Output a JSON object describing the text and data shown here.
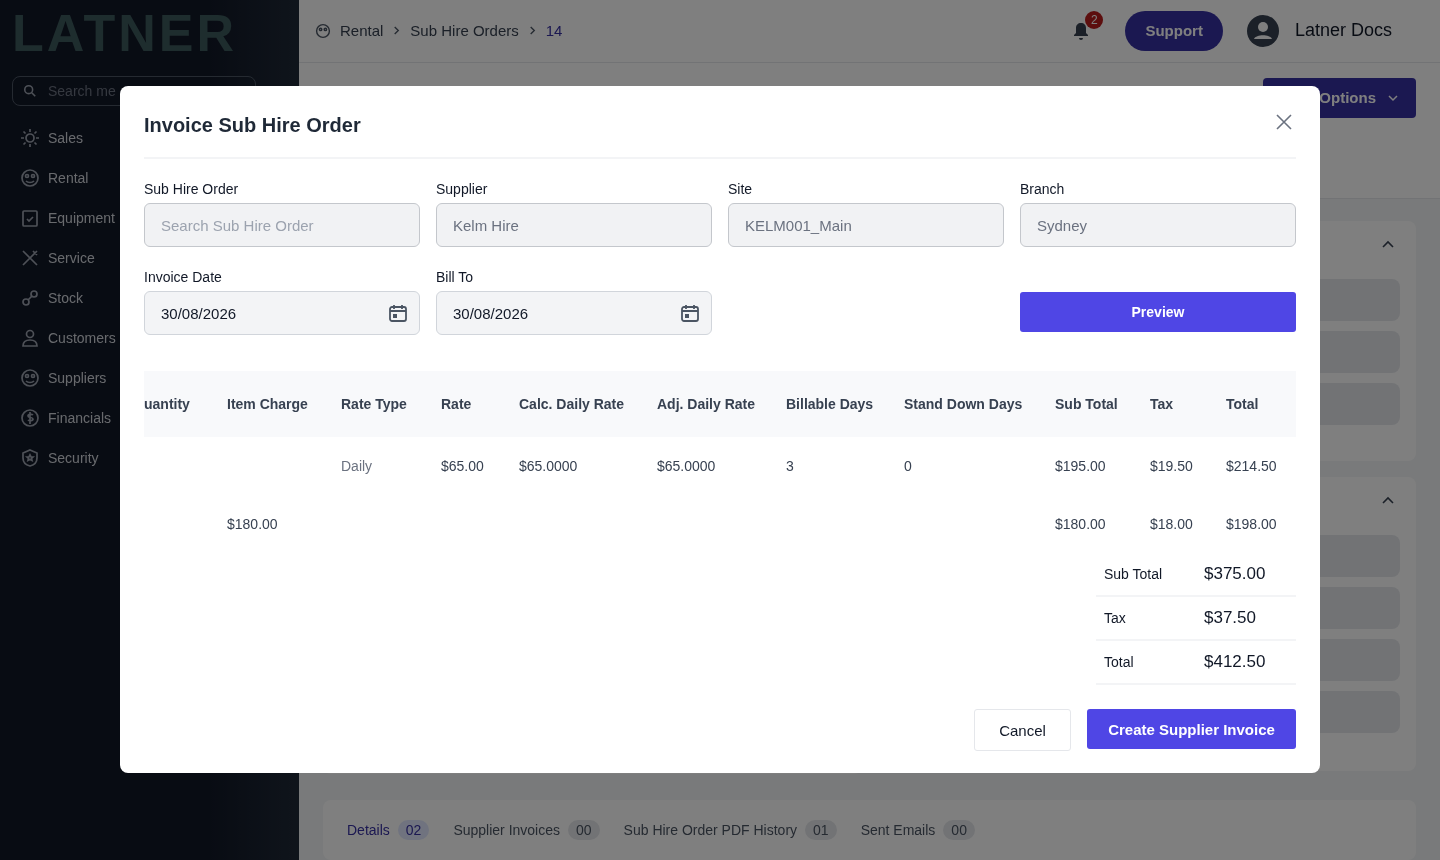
{
  "sidebar": {
    "logo": "LATNER",
    "search": {
      "placeholder": "Search me"
    },
    "items": [
      {
        "label": "Sales"
      },
      {
        "label": "Rental"
      },
      {
        "label": "Equipment"
      },
      {
        "label": "Service"
      },
      {
        "label": "Stock"
      },
      {
        "label": "Customers"
      },
      {
        "label": "Suppliers"
      },
      {
        "label": "Financials"
      },
      {
        "label": "Security"
      }
    ]
  },
  "breadcrumb": [
    {
      "label": "Rental",
      "current": false
    },
    {
      "label": "Sub Hire Orders",
      "current": false
    },
    {
      "label": "14",
      "current": true
    }
  ],
  "header": {
    "notifications": "2",
    "support": "Support",
    "user": "Latner Docs"
  },
  "page": {
    "options_button": "Options"
  },
  "tabs": [
    {
      "label": "Details",
      "count": "02",
      "selected": true
    },
    {
      "label": "Supplier Invoices",
      "count": "00",
      "selected": false
    },
    {
      "label": "Sub Hire Order PDF History",
      "count": "01",
      "selected": false
    },
    {
      "label": "Sent Emails",
      "count": "00",
      "selected": false
    }
  ],
  "modal": {
    "title": "Invoice Sub Hire Order",
    "fields": [
      {
        "label": "Sub Hire Order",
        "placeholder": "Search Sub Hire Order",
        "kind": "text",
        "disabled": true
      },
      {
        "label": "Supplier",
        "value": "Kelm Hire",
        "kind": "text",
        "disabled": true
      },
      {
        "label": "Site",
        "value": "KELM001_Main",
        "kind": "text",
        "disabled": true
      },
      {
        "label": "Branch",
        "value": "Sydney",
        "kind": "text",
        "disabled": true
      },
      {
        "label": "Invoice Date",
        "value": "30/08/2026",
        "kind": "date",
        "disabled": false
      },
      {
        "label": "Bill To",
        "value": "30/08/2026",
        "kind": "date",
        "disabled": false
      }
    ],
    "preview_button": "Preview",
    "table": {
      "columns": [
        "uantity",
        "Item Charge",
        "Rate Type",
        "Rate",
        "Calc. Daily Rate",
        "Adj. Daily Rate",
        "Billable Days",
        "Stand Down Days",
        "Sub Total",
        "Tax",
        "Total"
      ],
      "rows": [
        [
          null,
          null,
          "Daily",
          "$65.00",
          "$65.0000",
          "$65.0000",
          "3",
          "0",
          "$195.00",
          "$19.50",
          "$214.50"
        ],
        [
          null,
          "$180.00",
          null,
          null,
          null,
          null,
          null,
          null,
          "$180.00",
          "$18.00",
          "$198.00"
        ]
      ]
    },
    "totals": [
      {
        "label": "Sub Total",
        "value": "$375.00"
      },
      {
        "label": "Tax",
        "value": "$37.50"
      },
      {
        "label": "Total",
        "value": "$412.50"
      }
    ],
    "cancel_button": "Cancel",
    "submit_button": "Create Supplier Invoice"
  }
}
